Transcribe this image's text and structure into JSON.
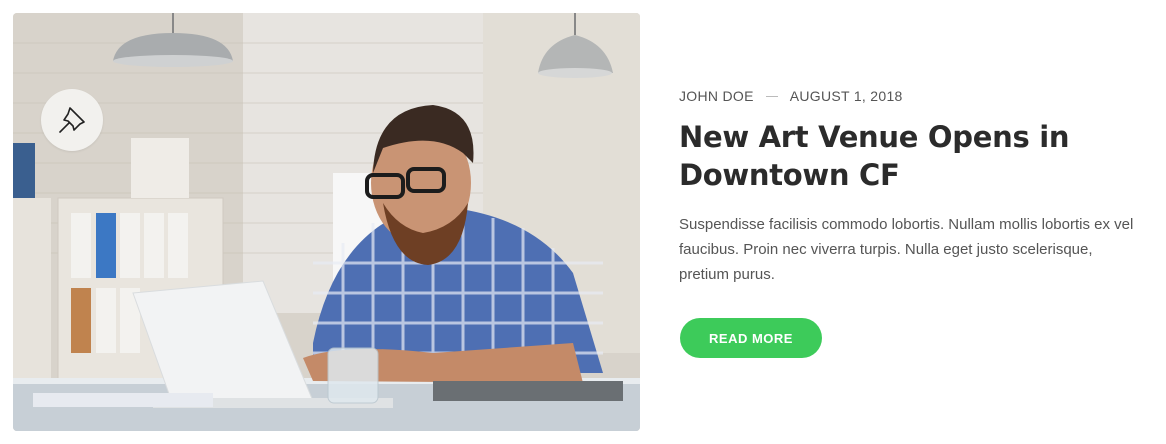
{
  "post": {
    "author": "JOHN DOE",
    "date": "AUGUST 1, 2018",
    "title": "New Art Venue Opens in Downtown CF",
    "excerpt": "Suspendisse facilisis commodo lobortis. Nullam mollis lobortis ex vel faucibus. Proin nec viverra turpis. Nulla eget justo scelerisque, pretium purus.",
    "read_more_label": "READ MORE",
    "featured_icon": "pin-icon"
  },
  "colors": {
    "accent": "#3dcb5a",
    "title": "#2b2b2b",
    "text": "#555555"
  }
}
